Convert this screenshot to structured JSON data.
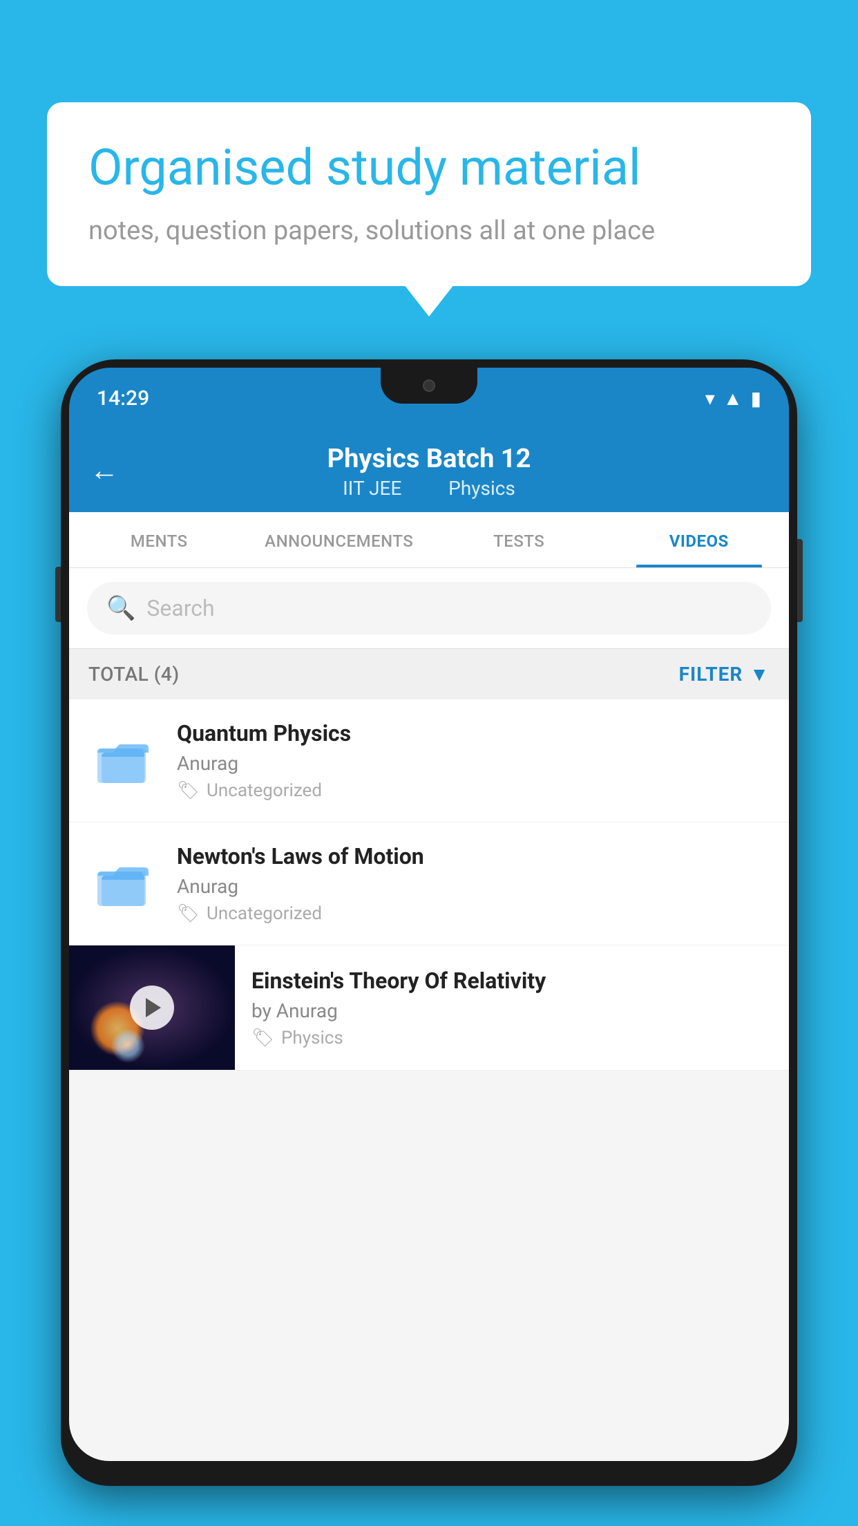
{
  "background_color": "#29B6E8",
  "bubble": {
    "title": "Organised study material",
    "subtitle": "notes, question papers, solutions all at one place"
  },
  "phone": {
    "status_bar": {
      "time": "14:29",
      "icons": [
        "wifi",
        "signal",
        "battery"
      ]
    },
    "header": {
      "back_label": "←",
      "title": "Physics Batch 12",
      "subtitle_part1": "IIT JEE",
      "subtitle_part2": "Physics"
    },
    "tabs": [
      {
        "label": "MENTS",
        "active": false
      },
      {
        "label": "ANNOUNCEMENTS",
        "active": false
      },
      {
        "label": "TESTS",
        "active": false
      },
      {
        "label": "VIDEOS",
        "active": true
      }
    ],
    "search": {
      "placeholder": "Search"
    },
    "filter": {
      "total_label": "TOTAL (4)",
      "filter_label": "FILTER"
    },
    "videos": [
      {
        "id": "v1",
        "title": "Quantum Physics",
        "author": "Anurag",
        "tag": "Uncategorized",
        "type": "folder"
      },
      {
        "id": "v2",
        "title": "Newton's Laws of Motion",
        "author": "Anurag",
        "tag": "Uncategorized",
        "type": "folder"
      },
      {
        "id": "v3",
        "title": "Einstein's Theory Of Relativity",
        "author": "by Anurag",
        "tag": "Physics",
        "type": "thumbnail"
      }
    ]
  }
}
